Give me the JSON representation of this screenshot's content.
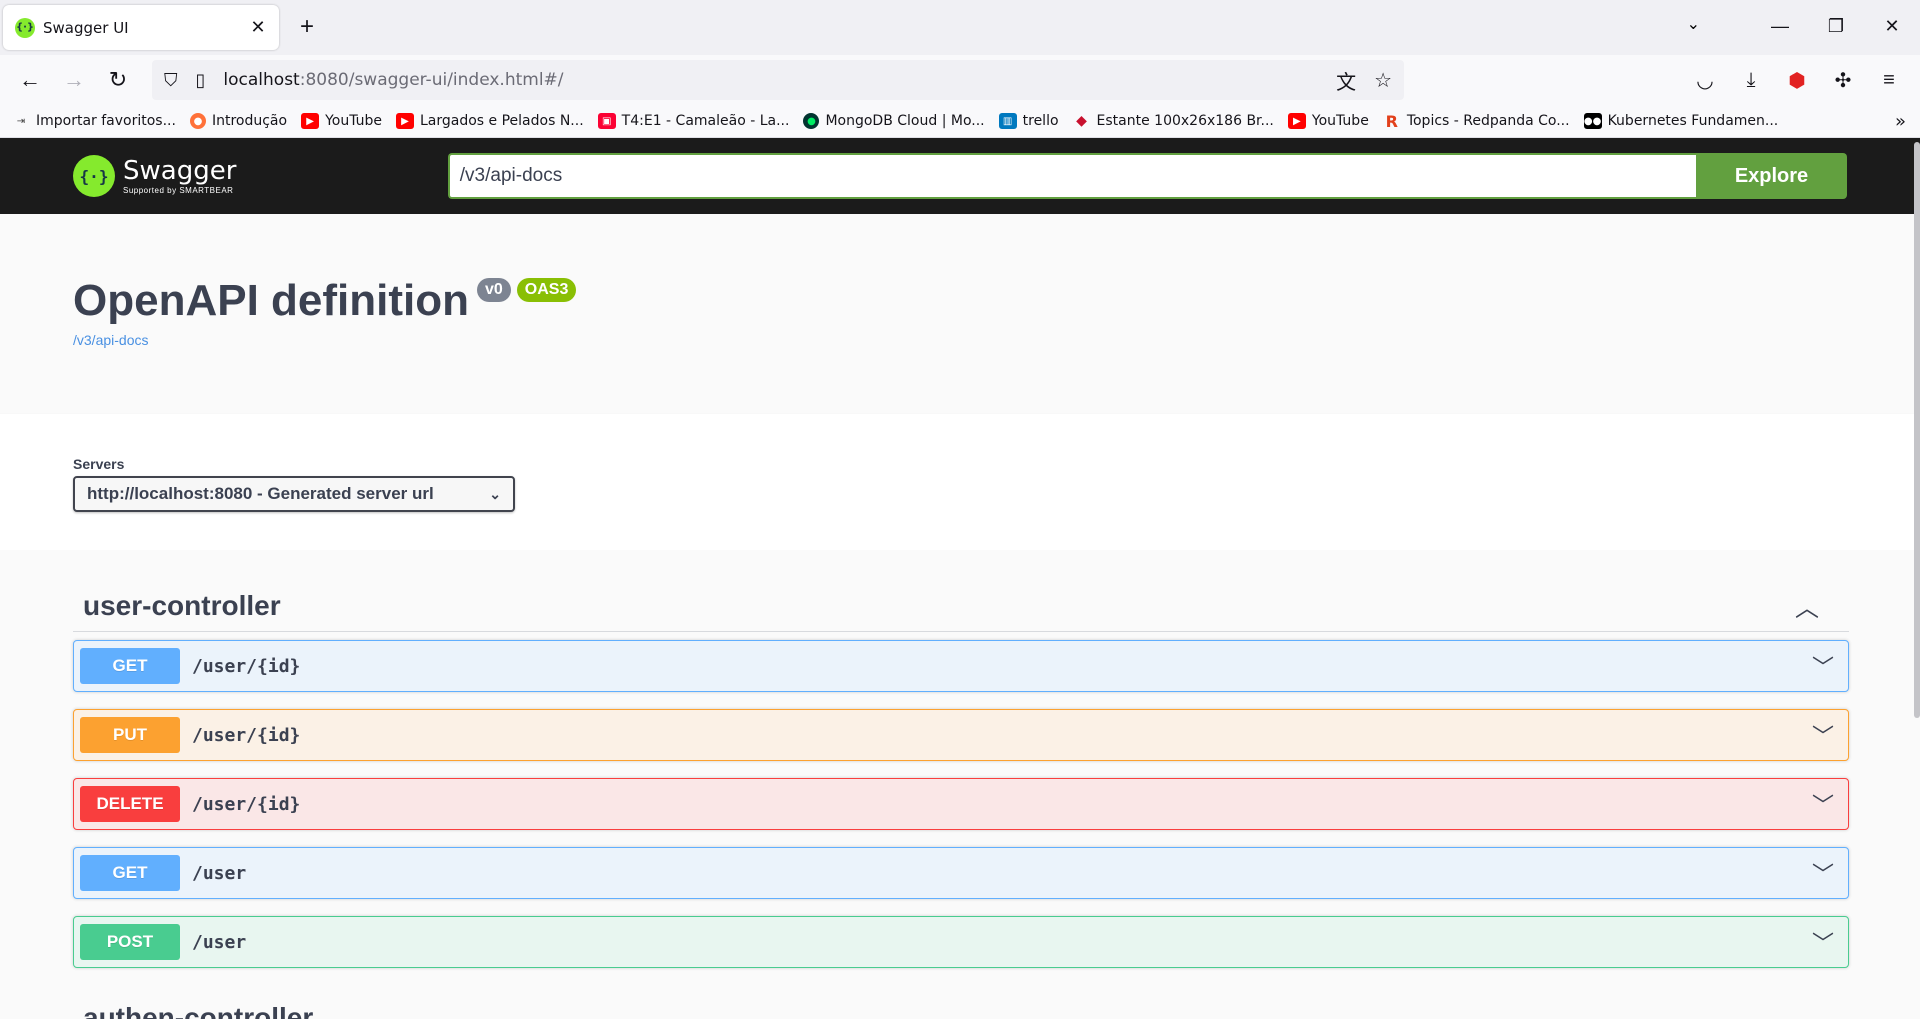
{
  "browser": {
    "tab_title": "Swagger UI",
    "url_host": "localhost",
    "url_path": ":8080/swagger-ui/index.html#/",
    "bookmarks": [
      {
        "label": "Importar favoritos...",
        "icon": "import-icon",
        "color": "#444444"
      },
      {
        "label": "Introdução",
        "icon": "firefox-icon",
        "color": "#ff7139"
      },
      {
        "label": "YouTube",
        "icon": "youtube-icon",
        "color": "#ff0000"
      },
      {
        "label": "Largados e Pelados N...",
        "icon": "youtube-icon",
        "color": "#ff0000"
      },
      {
        "label": "T4:E1 - Camaleão - La...",
        "icon": "globoplay-icon",
        "color": "#fb0234"
      },
      {
        "label": "MongoDB Cloud | Mo...",
        "icon": "mongodb-icon",
        "color": "#023430"
      },
      {
        "label": "trello",
        "icon": "trello-icon",
        "color": "#0079bf"
      },
      {
        "label": "Estante 100x26x186 Br...",
        "icon": "store-icon",
        "color": "#c8102e"
      },
      {
        "label": "YouTube",
        "icon": "youtube-icon",
        "color": "#ff0000"
      },
      {
        "label": "Topics - Redpanda Co...",
        "icon": "redpanda-icon",
        "color": "#e2401b"
      },
      {
        "label": "Kubernetes Fundamen...",
        "icon": "medium-icon",
        "color": "#000000"
      }
    ]
  },
  "swagger": {
    "logo_text": "Swagger",
    "logo_sub": "Supported by SMARTBEAR",
    "spec_url": "/v3/api-docs",
    "explore_label": "Explore",
    "info": {
      "title": "OpenAPI definition",
      "version": "v0",
      "oas": "OAS3",
      "link": "/v3/api-docs"
    },
    "servers": {
      "label": "Servers",
      "selected": "http://localhost:8080 - Generated server url"
    },
    "tags": [
      {
        "name": "user-controller",
        "operations": [
          {
            "method": "GET",
            "path": "/user/{id}"
          },
          {
            "method": "PUT",
            "path": "/user/{id}"
          },
          {
            "method": "DELETE",
            "path": "/user/{id}"
          },
          {
            "method": "GET",
            "path": "/user"
          },
          {
            "method": "POST",
            "path": "/user"
          }
        ]
      },
      {
        "name": "authen-controller",
        "operations": []
      }
    ]
  }
}
